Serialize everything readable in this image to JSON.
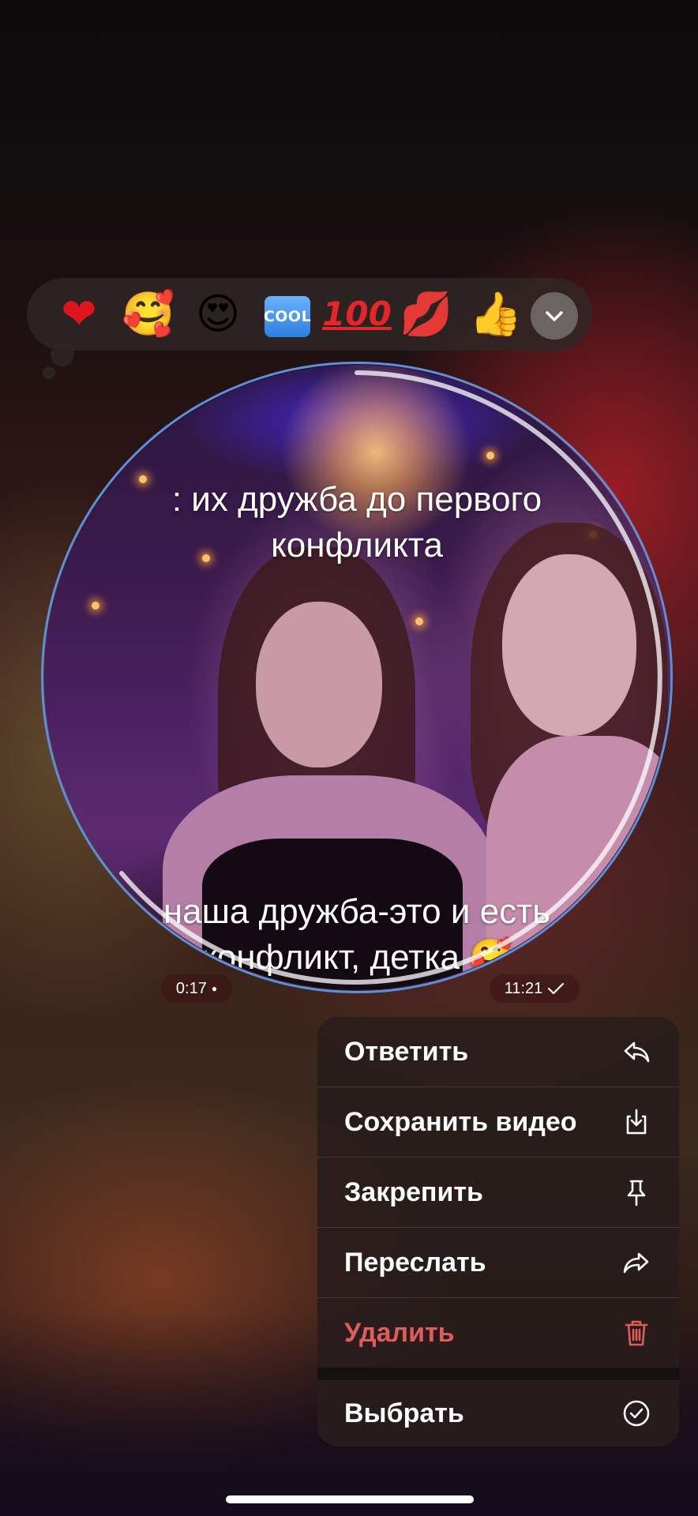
{
  "reactions": {
    "items": [
      {
        "name": "red-heart",
        "glyph": "❤"
      },
      {
        "name": "smiling-face-with-hearts",
        "glyph": "🥰"
      },
      {
        "name": "heart-eyes",
        "glyph": "😍"
      },
      {
        "name": "cool-button",
        "glyph": "COOL"
      },
      {
        "name": "hundred-points",
        "glyph": "100"
      },
      {
        "name": "kiss-mark",
        "glyph": "💋"
      },
      {
        "name": "thumbs-up",
        "glyph": "👍"
      }
    ],
    "expand_icon": "chevron-down-icon"
  },
  "video": {
    "caption_top_line1": ": их дружба до первого",
    "caption_top_line2": "конфликта",
    "caption_bottom_line1": "наша дружба-это и есть",
    "caption_bottom_line2": "конфликт, детка 🥰",
    "duration": "0:17",
    "time": "11:21",
    "ring_color": "#5d8fe0"
  },
  "menu": {
    "items": [
      {
        "label": "Ответить",
        "icon": "reply-icon"
      },
      {
        "label": "Сохранить видео",
        "icon": "save-icon"
      },
      {
        "label": "Закрепить",
        "icon": "pin-icon"
      },
      {
        "label": "Переслать",
        "icon": "forward-icon"
      },
      {
        "label": "Удалить",
        "icon": "trash-icon",
        "color": "#e05b5b"
      },
      {
        "label": "Выбрать",
        "icon": "check-circle-icon"
      }
    ]
  }
}
